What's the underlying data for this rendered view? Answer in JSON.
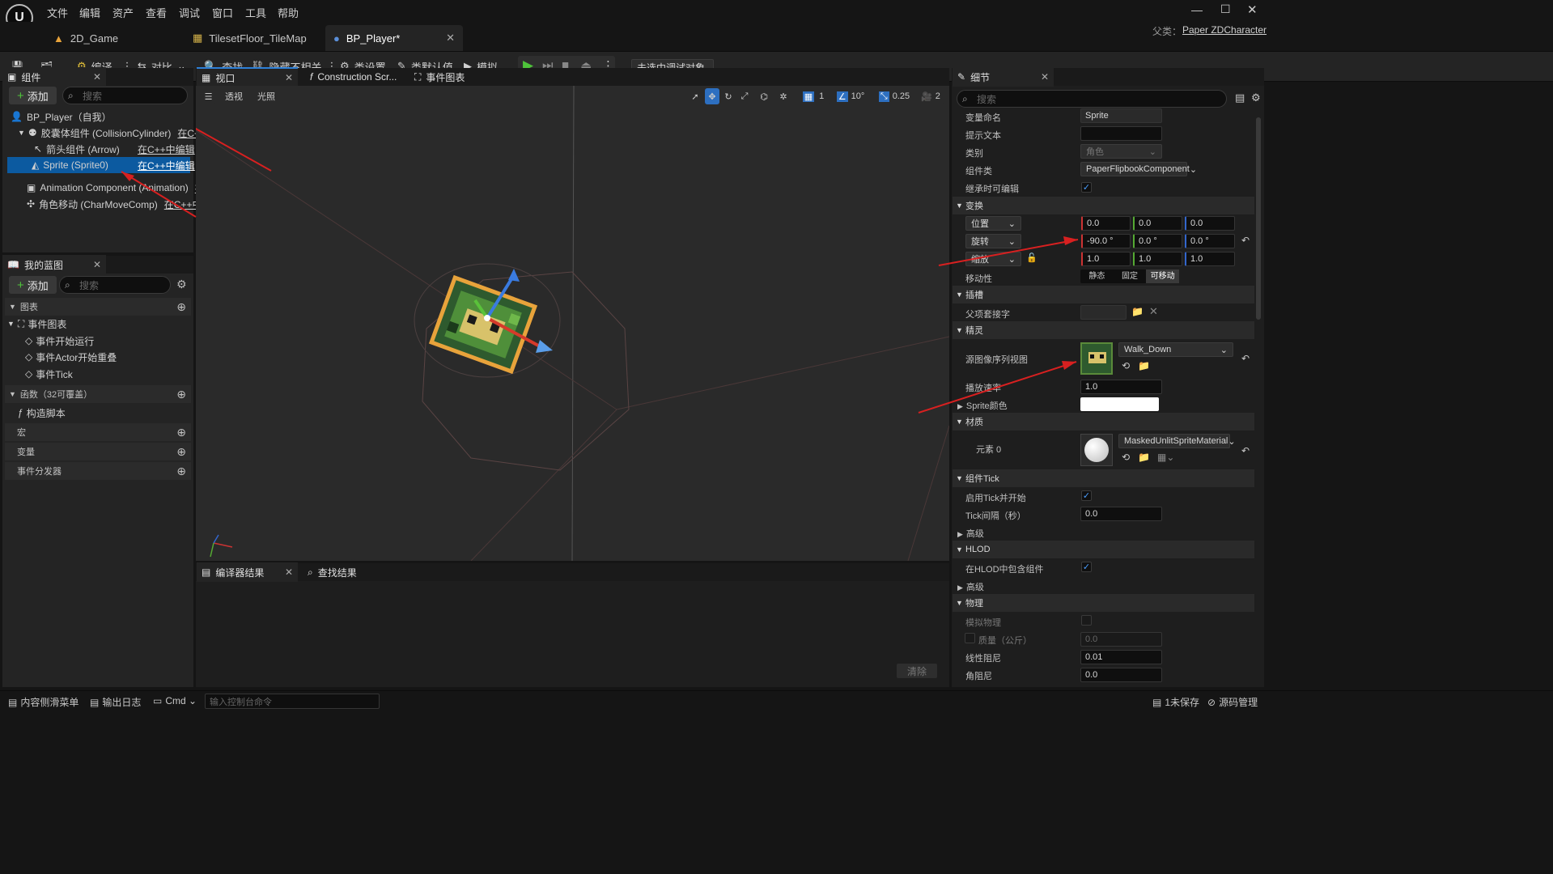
{
  "menu": [
    "文件",
    "编辑",
    "资产",
    "查看",
    "调试",
    "窗口",
    "工具",
    "帮助"
  ],
  "tabs": [
    {
      "label": "2D_Game"
    },
    {
      "label": "TilesetFloor_TileMap"
    },
    {
      "label": "BP_Player*"
    }
  ],
  "parent": {
    "label": "父类：",
    "value": "Paper ZDCharacter"
  },
  "toolbar": {
    "compile": "编译",
    "diff": "对比",
    "find": "查找",
    "hide_unrelated": "隐藏不相关",
    "class_settings": "类设置",
    "class_defaults": "类默认值",
    "simulate": "模拟",
    "debug_target": "未选中调试对象"
  },
  "components": {
    "tab": "组件",
    "add": "添加",
    "search_placeholder": "搜索",
    "items": [
      {
        "label": "BP_Player（自我）",
        "edit": ""
      },
      {
        "label": "胶囊体组件 (CollisionCylinder)",
        "edit": "在C++中"
      },
      {
        "label": "箭头组件 (Arrow)",
        "edit": "在C++中编辑"
      },
      {
        "label": "Sprite (Sprite0)",
        "edit": "在C++中编辑"
      },
      {
        "label": "Animation Component (Animation)",
        "edit": "在C"
      },
      {
        "label": "角色移动 (CharMoveComp)",
        "edit": "在C++中编"
      }
    ]
  },
  "myblueprint": {
    "tab": "我的蓝图",
    "add": "添加",
    "search_placeholder": "搜索",
    "graphs": "图表",
    "event_graph": "事件图表",
    "events": [
      "事件开始运行",
      "事件Actor开始重叠",
      "事件Tick"
    ],
    "functions": "函数（32可覆盖）",
    "construction": "构造脚本",
    "macros": "宏",
    "variables": "变量",
    "dispatchers": "事件分发器"
  },
  "viewport": {
    "tabs": [
      "视口",
      "Construction Scr...",
      "事件图表"
    ],
    "perspective": "透视",
    "lighting": "光照",
    "grid": "1",
    "angle": "10°",
    "scale": "0.25",
    "camera": "2"
  },
  "compiler": {
    "tab": "编译器结果",
    "find_results": "查找结果",
    "clear": "清除"
  },
  "details": {
    "tab": "细节",
    "search_placeholder": "搜索",
    "var_name_label": "变量命名",
    "var_name": "Sprite",
    "tooltip_label": "提示文本",
    "tooltip": "",
    "category_label": "类别",
    "category": "角色",
    "comp_class_label": "组件类",
    "comp_class": "PaperFlipbookComponent",
    "editable_label": "继承时可编辑",
    "transform": "变换",
    "location": "位置",
    "rotation": "旋转",
    "scale": "缩放",
    "loc": [
      "0.0",
      "0.0",
      "0.0"
    ],
    "rot": [
      "-90.0 °",
      "0.0 °",
      "0.0 °"
    ],
    "scl": [
      "1.0",
      "1.0",
      "1.0"
    ],
    "mobility_label": "移动性",
    "mobility": [
      "静态",
      "固定",
      "可移动"
    ],
    "sockets": "插槽",
    "parent_socket": "父项套接字",
    "sprite": "精灵",
    "source_flipbook": "源图像序列视图",
    "flipbook": "Walk_Down",
    "play_rate_label": "播放速率",
    "play_rate": "1.0",
    "sprite_color": "Sprite颜色",
    "materials": "材质",
    "element0": "元素 0",
    "material": "MaskedUnlitSpriteMaterial",
    "comp_tick": "组件Tick",
    "tick_start": "启用Tick并开始",
    "tick_interval_label": "Tick间隔（秒）",
    "tick_interval": "0.0",
    "advanced": "高级",
    "hlod": "HLOD",
    "include_hlod": "在HLOD中包含组件",
    "advanced2": "高级",
    "physics": "物理",
    "simulate_physics": "模拟物理",
    "mass": "质量（公斤）",
    "mass_val": "0.0",
    "linear_damping": "线性阻尼",
    "linear_damping_val": "0.01",
    "angular_damping": "角阻尼",
    "angular_damping_val": "0.0"
  },
  "status": {
    "content_drawer": "内容侧滑菜单",
    "output_log": "输出日志",
    "cmd": "Cmd",
    "console_placeholder": "输入控制台命令",
    "unsaved": "1未保存",
    "source_control": "源码管理"
  }
}
